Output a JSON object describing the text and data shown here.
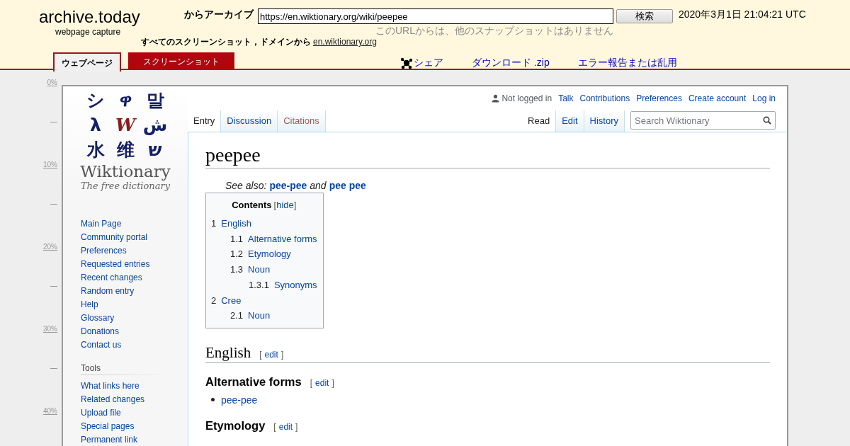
{
  "header": {
    "logo_title": "archive.today",
    "logo_subtitle": "webpage capture",
    "archive_label": "からアーカイブ",
    "url_value": "https://en.wiktionary.org/wiki/peepee",
    "search_button": "検索",
    "timestamp": "2020年3月1日 21:04:21 UTC",
    "no_snapshots": "このURLからは、他のスナップショットはありません",
    "all_screenshots": "すべてのスクリーンショット，ドメインから",
    "domain_link": "en.wiktionary.org",
    "tabs": [
      {
        "label": "ウェブページ",
        "selected": true
      },
      {
        "label": "スクリーンショット",
        "selected": false
      }
    ],
    "actions": [
      {
        "label": "シェア",
        "kind": "share"
      },
      {
        "label": "ダウンロード .zip",
        "kind": "download"
      },
      {
        "label": "エラー報告または乱用",
        "kind": "report"
      }
    ]
  },
  "ruler": [
    "0%",
    "10%",
    "20%",
    "30%",
    "40%"
  ],
  "wiki": {
    "logo_glyphs": [
      "シ",
      "ዋ",
      "말",
      "λ",
      "W",
      "ش",
      "水",
      "维",
      "ש"
    ],
    "wordmark": "Wiktionary",
    "tagline": "The free dictionary",
    "not_logged_in": "Not logged in",
    "personal_links": [
      "Talk",
      "Contributions",
      "Preferences",
      "Create account",
      "Log in"
    ],
    "left_tabs": [
      {
        "label": "Entry",
        "selected": true,
        "exists": true
      },
      {
        "label": "Discussion",
        "selected": false,
        "exists": true
      },
      {
        "label": "Citations",
        "selected": false,
        "exists": false
      }
    ],
    "right_tabs": [
      {
        "label": "Read",
        "selected": true
      },
      {
        "label": "Edit",
        "selected": false
      },
      {
        "label": "History",
        "selected": false
      }
    ],
    "search": {
      "placeholder": "Search Wiktionary"
    },
    "nav": [
      "Main Page",
      "Community portal",
      "Preferences",
      "Requested entries",
      "Recent changes",
      "Random entry",
      "Help",
      "Glossary",
      "Donations",
      "Contact us"
    ],
    "tools": {
      "heading": "Tools",
      "items": [
        "What links here",
        "Related changes",
        "Upload file",
        "Special pages",
        "Permanent link"
      ]
    },
    "title": "peepee",
    "see_also": {
      "prefix": "See also:",
      "joiner": "and",
      "links": [
        "pee-pee",
        "pee pee"
      ]
    },
    "bracket_open": "[",
    "bracket_close": "]",
    "toc": {
      "title": "Contents",
      "toggle": "hide",
      "items": [
        {
          "number": "1",
          "label": "English",
          "children": [
            {
              "number": "1.1",
              "label": "Alternative forms"
            },
            {
              "number": "1.2",
              "label": "Etymology"
            },
            {
              "number": "1.3",
              "label": "Noun",
              "children": [
                {
                  "number": "1.3.1",
                  "label": "Synonyms"
                }
              ]
            }
          ]
        },
        {
          "number": "2",
          "label": "Cree",
          "children": [
            {
              "number": "2.1",
              "label": "Noun"
            }
          ]
        }
      ]
    },
    "sections": [
      {
        "kind": "h2",
        "title": "English",
        "edit": "edit"
      },
      {
        "kind": "h3",
        "title": "Alternative forms",
        "edit": "edit",
        "bullets": [
          "pee-pee"
        ]
      },
      {
        "kind": "h3",
        "title": "Etymology",
        "edit": "edit"
      }
    ]
  }
}
